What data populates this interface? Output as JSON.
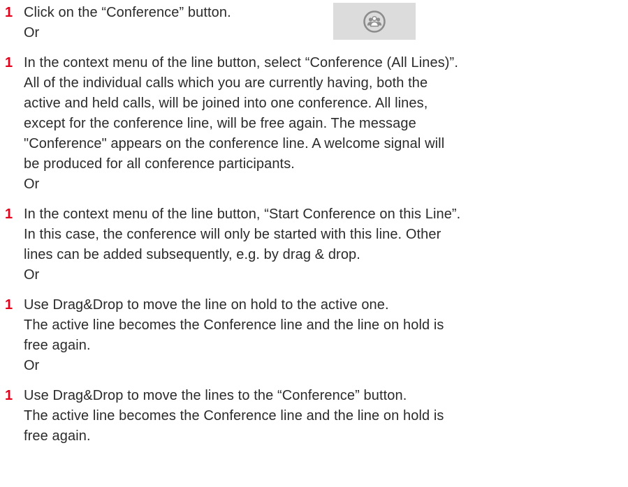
{
  "steps": [
    {
      "number": "1",
      "lines": [
        "Click on the “Conference” button."
      ],
      "or": "Or",
      "button_icon": "conference-icon"
    },
    {
      "number": "1",
      "lines": [
        "In the context menu of the line button, select “Conference (All Lines)”.",
        "All of the individual calls which you are currently having, both the",
        "active and held calls, will be joined into one conference. All lines,",
        "except for the conference line, will be free again. The message",
        "\"Conference\" appears on the conference line. A welcome signal will",
        "be produced for all conference participants."
      ],
      "or": "Or"
    },
    {
      "number": "1",
      "lines": [
        "In the context menu of the line button, “Start Conference on this Line”.",
        "In this case, the conference will only be started with this line. Other",
        "lines can be added subsequently, e.g. by drag & drop."
      ],
      "or": "Or"
    },
    {
      "number": "1",
      "lines": [
        "Use Drag&Drop to move the line on hold to the active one.",
        "The active line becomes the Conference line and the line on hold is",
        "free again."
      ],
      "or": "Or"
    },
    {
      "number": "1",
      "lines": [
        "Use Drag&Drop to move the lines to the “Conference” button.",
        "The active line becomes the Conference line and the line on hold is",
        "free again."
      ]
    }
  ],
  "colors": {
    "step_number": "#e2001a",
    "text": "#2b2b2b",
    "button_bg": "#dcdcdc",
    "icon": "#8c8c8c"
  }
}
